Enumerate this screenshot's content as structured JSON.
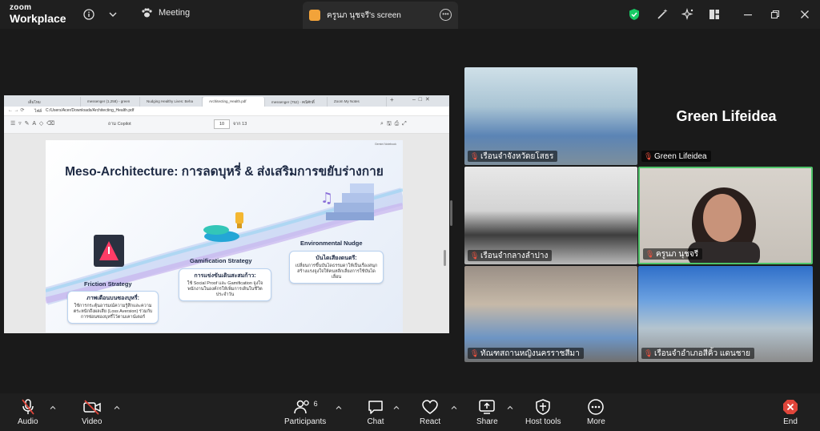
{
  "app": {
    "logo_line1": "zoom",
    "logo_line2": "Workplace",
    "meeting_label": "Meeting",
    "screen_tab": "ครูนภ นุชจรี's screen"
  },
  "browser": {
    "tabs": [
      "เต็มโหม",
      "messenger (1,258) - green",
      "Nudging Healthy Lives: Beha",
      "Architecting_Health.pdf",
      "messenger (752) - คณิศักดิ์",
      "Zoom My Notes"
    ],
    "url_label": "ไฟล์",
    "url": "C:/Users/Acer/Downloads/Architecting_Health.pdf",
    "copilot": "ถาม Copilot",
    "page_num": "10",
    "page_total": "จาก 13"
  },
  "slide": {
    "title": "Meso-Architecture: การลดบุหรี่ & ส่งเสริมการขยับร่างกาย",
    "notebook": "Gemini Notebook",
    "friction": {
      "label": "Friction Strategy",
      "card_title": "ภาพเตือนบนซองบุหรี่:",
      "card_body": "ใช้การกระตุ้นอารมณ์ความรู้สึกและความตระหนักถึงผลเสีย (Loss Aversion) ร่วมกับการซ่อนซองบุหรี่ไว้ตามเคาน์เตอร์"
    },
    "gamification": {
      "label": "Gamification Strategy",
      "card_title": "การแข่งขันเดินสะสมก้าว:",
      "card_body": "ใช้ Social Proof และ Gamification จูงใจพนักงานในองค์กรให้เพิ่มการเดินในชีวิตประจำวัน"
    },
    "environment": {
      "label": "Environmental Nudge",
      "card_title": "บันไดเสียงดนตรี:",
      "card_body": "เปลี่ยนการขึ้นบันไดธรรมดาให้เป็นเรื่องสนุก สร้างแรงจูงใจให้คนหลีกเลี่ยงการใช้บันไดเลื่อน"
    }
  },
  "participants": {
    "tile1": "เรือนจำจังหวัดยโสธร",
    "tile2": "Green Lifeidea",
    "tile2_big": "Green Lifeidea",
    "tile3": "เรือนจำกลางลำปาง",
    "tile4": "ครูนภ นุชจรี",
    "tile5": "ทัณฑสถานหญิงนครราชสีมา",
    "tile6": "เรือนจำอำเภอสีคิ้ว แดนชาย"
  },
  "toolbar": {
    "audio": "Audio",
    "video": "Video",
    "participants": "Participants",
    "participants_count": "6",
    "chat": "Chat",
    "react": "React",
    "share": "Share",
    "host_tools": "Host tools",
    "more": "More",
    "end": "End"
  },
  "colors": {
    "shield": "#17c964",
    "end": "#e0453a",
    "mic_off": "#f0523f",
    "active_border": "#4fc36a"
  }
}
